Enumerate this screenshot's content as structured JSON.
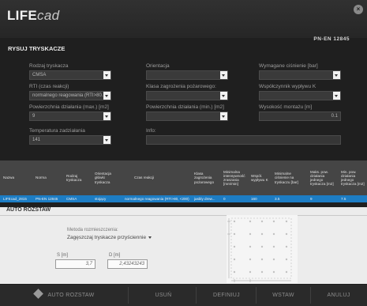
{
  "header": {
    "logo_main": "LIFE",
    "logo_sub": "cad",
    "norm": "PN-EN 12845",
    "title": "RYSUJ TRYSKACZE",
    "close_icon": "close-icon"
  },
  "form": {
    "rodzaj": {
      "label": "Rodzaj tryskacza",
      "value": "CMSA"
    },
    "orientacja": {
      "label": "Orientacja",
      "value": ""
    },
    "cisnienie": {
      "label": "Wymagane ciśnienie [bar]",
      "value": ""
    },
    "rti": {
      "label": "RTI (czas reakcji)",
      "value": "normalnego reagowania (RTI>80..."
    },
    "klasa": {
      "label": "Klasa zagrożenia pożarowego:",
      "value": ""
    },
    "wspolczynnik": {
      "label": "Współczynnik wypływu K",
      "value": ""
    },
    "pow_max": {
      "label": "Powierzchnia działania (max.) [m2]",
      "value": "9"
    },
    "pow_min": {
      "label": "Powierzchnia działania (min.) [m2]",
      "value": ""
    },
    "wysokosc": {
      "label": "Wysokość montażu [m]",
      "value": "0.1"
    },
    "temperatura": {
      "label": "Temperatura zadziałania",
      "value": "141"
    },
    "info": {
      "label": "Info:",
      "value": ""
    }
  },
  "table": {
    "headers": [
      "Nazwa",
      "Norma",
      "Rodzaj tryskacza",
      "Orientacja główki tryskacza",
      "Czas reakcji",
      "Klasa zagrożenia pożarowego",
      "Minimalna intensywność zraszania [mm/min]",
      "Współ. wypływu K",
      "Minimalne ciśnienie na tryskaczu [bar]",
      "Maks. pow. działania jednego tryskacza [m2]",
      "Min. pow. działania jednego tryskacza [m2]"
    ],
    "row": [
      "LIFEcad_2815",
      "PN-EN 12845",
      "CMSA",
      "stojący",
      "normalnego reagowania (RTI>80, <200)",
      "jasbly drew...",
      "0",
      "160",
      "3.5",
      "9",
      "7.5"
    ]
  },
  "auto": {
    "title": "AUTO ROZSTAW",
    "method_label": "Metoda rozmieszczenia:",
    "method_value": "Zagęszczaj tryskacze przyściennie",
    "s_label": "S [m]",
    "s_value": "3,7",
    "d_label": "D [m]",
    "d_value": "2,43243243"
  },
  "footer": {
    "auto": "AUTO ROZSTAW",
    "usun": "USUŃ",
    "definiuj": "DEFINIUJ",
    "wstaw": "WSTAW",
    "anuluj": "ANULUJ"
  }
}
